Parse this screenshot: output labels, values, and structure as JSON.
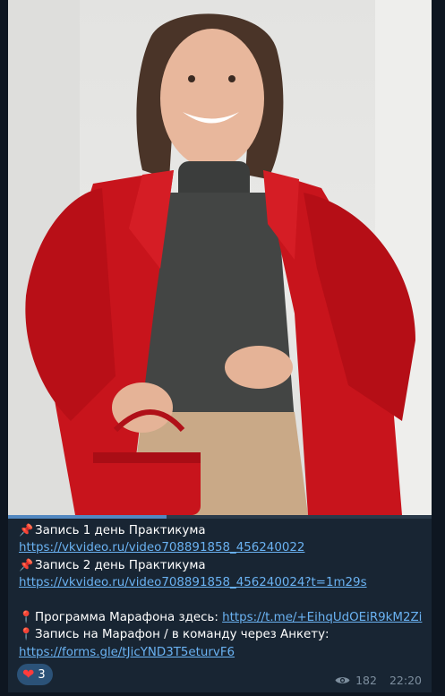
{
  "post": {
    "photo_alt": "",
    "video_progress_fraction": 0.375,
    "lines": [
      {
        "pin": "📌",
        "text": "Запись 1 день Практикума",
        "url": ""
      },
      {
        "pin": "",
        "text": "",
        "url": "https://vkvideo.ru/video708891858_456240022"
      },
      {
        "pin": "📌",
        "text": "Запись 2 день Практикума",
        "url": ""
      },
      {
        "pin": "",
        "text": "",
        "url": "https://vkvideo.ru/video708891858_456240024?t=1m29s"
      }
    ],
    "line_program": {
      "pin": "📍",
      "text": "Программа Марафона здесь: ",
      "url": "https://t.me/+EihqUdOEiR9kM2Zi"
    },
    "line_signup": {
      "pin": "📍",
      "text": "Запись на Марафон / в команду через Анкету:",
      "url": ""
    },
    "line_form": {
      "pin": "",
      "text": "",
      "url": "https://forms.gle/tJicYND3T5eturvF6"
    }
  },
  "reaction": {
    "icon": "heart-icon",
    "count": "3"
  },
  "meta": {
    "views": "182",
    "time": "22:20",
    "eye_icon": "eye-icon"
  },
  "colors": {
    "background": "#0e1621",
    "bubble": "#182533",
    "link": "#6ab2f2",
    "reaction_bg": "#2b5278"
  }
}
